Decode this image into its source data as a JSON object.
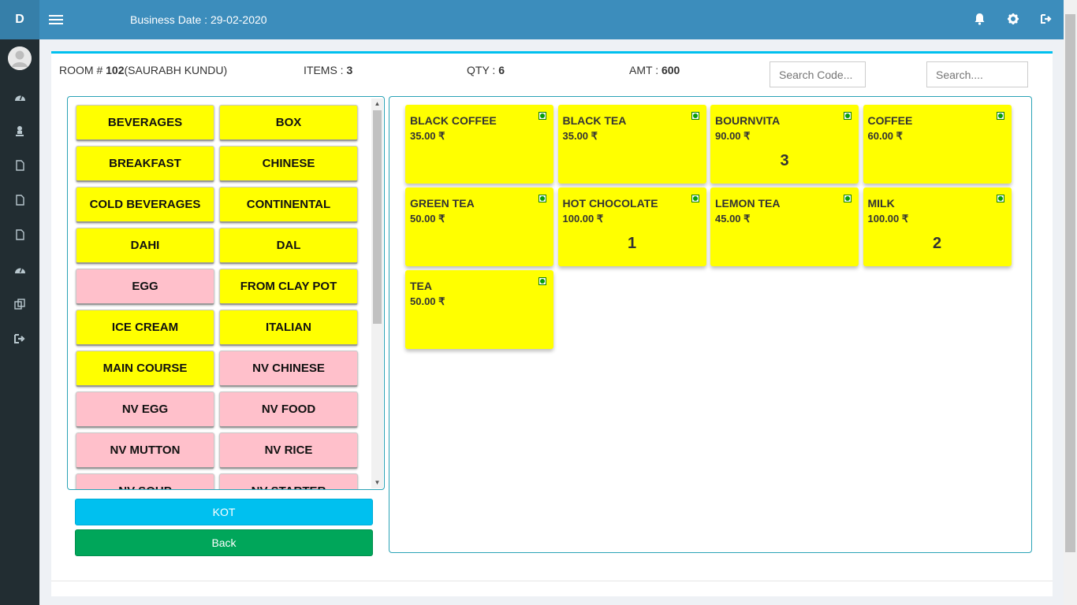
{
  "header": {
    "brand": "D",
    "business_date": "Business Date : 29-02-2020"
  },
  "icons": {
    "menu": "hamburger-icon",
    "notifications": "bell-icon",
    "settings": "gear-icon",
    "logout": "sign-out-icon"
  },
  "sidebar": {
    "items": [
      {
        "icon": "dashboard-icon"
      },
      {
        "icon": "user-icon"
      },
      {
        "icon": "file-icon"
      },
      {
        "icon": "file-icon"
      },
      {
        "icon": "file-icon"
      },
      {
        "icon": "dashboard-icon"
      },
      {
        "icon": "copy-icon"
      },
      {
        "icon": "sign-out-icon"
      }
    ]
  },
  "summary": {
    "room_label": "ROOM # ",
    "room_number": "102",
    "guest": "(SAURABH KUNDU)",
    "items_label": "ITEMS : ",
    "items_value": "3",
    "qty_label": "QTY : ",
    "qty_value": "6",
    "amt_label": "AMT : ",
    "amt_value": "600"
  },
  "search": {
    "code_placeholder": "Search Code...",
    "text_placeholder": "Search...."
  },
  "categories": [
    {
      "label": "BEVERAGES",
      "type": "veg"
    },
    {
      "label": "BOX",
      "type": "veg"
    },
    {
      "label": "BREAKFAST",
      "type": "veg"
    },
    {
      "label": "CHINESE",
      "type": "veg"
    },
    {
      "label": "COLD BEVERAGES",
      "type": "veg"
    },
    {
      "label": "CONTINENTAL",
      "type": "veg"
    },
    {
      "label": "DAHI",
      "type": "veg"
    },
    {
      "label": "DAL",
      "type": "veg"
    },
    {
      "label": "EGG",
      "type": "nv"
    },
    {
      "label": "FROM CLAY POT",
      "type": "veg"
    },
    {
      "label": "ICE CREAM",
      "type": "veg"
    },
    {
      "label": "ITALIAN",
      "type": "veg"
    },
    {
      "label": "MAIN COURSE",
      "type": "veg"
    },
    {
      "label": "NV CHINESE",
      "type": "nv"
    },
    {
      "label": "NV EGG",
      "type": "nv"
    },
    {
      "label": "NV FOOD",
      "type": "nv"
    },
    {
      "label": "NV MUTTON",
      "type": "nv"
    },
    {
      "label": "NV RICE",
      "type": "nv"
    },
    {
      "label": "NV SOUP",
      "type": "nv"
    },
    {
      "label": "NV STARTER",
      "type": "nv"
    }
  ],
  "buttons": {
    "kot": "KOT",
    "back": "Back"
  },
  "items": [
    {
      "name": "BLACK COFFEE",
      "price": "35.00 ₹",
      "qty": ""
    },
    {
      "name": "BLACK TEA",
      "price": "35.00 ₹",
      "qty": ""
    },
    {
      "name": "BOURNVITA",
      "price": "90.00 ₹",
      "qty": "3"
    },
    {
      "name": "COFFEE",
      "price": "60.00 ₹",
      "qty": ""
    },
    {
      "name": "GREEN TEA",
      "price": "50.00 ₹",
      "qty": ""
    },
    {
      "name": "HOT CHOCOLATE",
      "price": "100.00 ₹",
      "qty": "1"
    },
    {
      "name": "LEMON TEA",
      "price": "45.00 ₹",
      "qty": ""
    },
    {
      "name": "MILK",
      "price": "100.00 ₹",
      "qty": "2"
    },
    {
      "name": "TEA",
      "price": "50.00 ₹",
      "qty": ""
    }
  ],
  "colors": {
    "header": "#3c8dbc",
    "sidebar": "#222d32",
    "veg_tile": "#ffff00",
    "nonveg_tile": "#ffc0cb",
    "kot_button": "#00c0ef",
    "back_button": "#00a65a"
  }
}
